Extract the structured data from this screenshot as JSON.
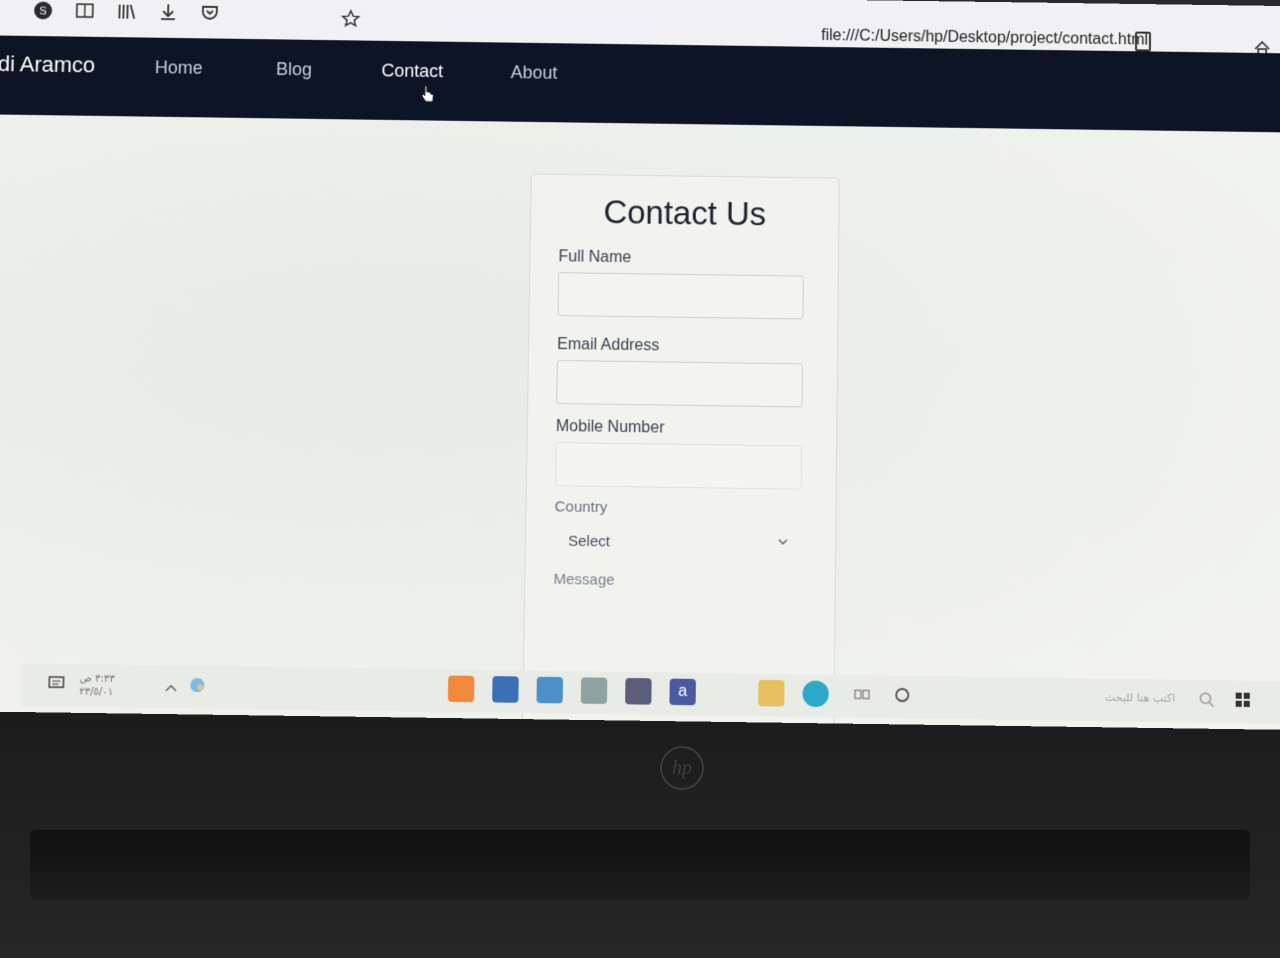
{
  "browser": {
    "url": "file:///C:/Users/hp/Desktop/project/contact.html",
    "toolbar_icons": [
      "skype-icon",
      "reader-view-icon",
      "library-icon",
      "download-icon",
      "pocket-icon",
      "bookmark-star-icon",
      "page-icon",
      "home-icon"
    ]
  },
  "navbar": {
    "brand": "di Aramco",
    "links": [
      "Home",
      "Blog",
      "Contact",
      "About"
    ],
    "active": "Contact"
  },
  "form": {
    "title": "Contact Us",
    "full_name_label": "Full Name",
    "email_label": "Email Address",
    "mobile_label": "Mobile Number",
    "country_label": "Country",
    "country_value": "Select",
    "message_label": "Message"
  },
  "taskbar": {
    "clock_time": "٣:٣٣ ص",
    "clock_date": "٢٣/٥/٠١",
    "search_hint": "اكتب هنا للبحث",
    "apps": [
      "firefox-icon",
      "calendar-app-icon",
      "mail-app-icon",
      "photos-app-icon",
      "store-icon",
      "amazon-icon",
      "file-explorer-icon",
      "edge-icon",
      "task-view-icon",
      "cortana-icon",
      "windows-start-icon"
    ]
  },
  "device": {
    "logo": "hp"
  },
  "colors": {
    "navbar_bg": "#0c1425",
    "nav_active": "#ffffff",
    "nav_inactive": "#c9cfda",
    "page_bg": "#eef0ec"
  }
}
